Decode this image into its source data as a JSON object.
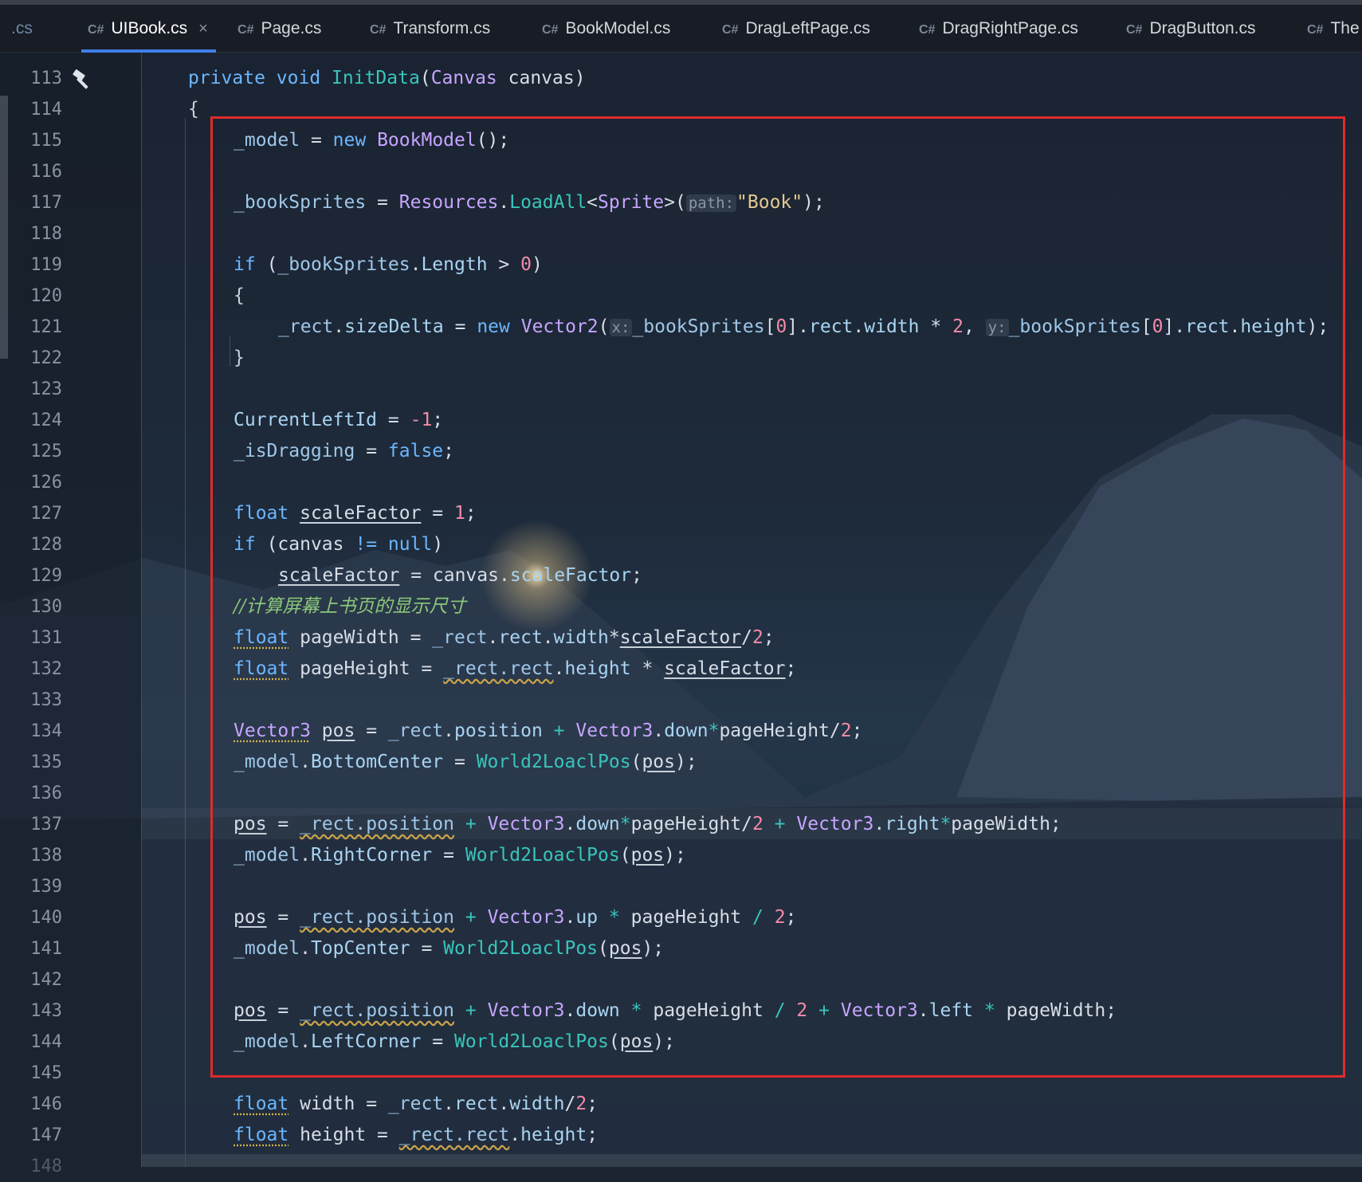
{
  "tabs": [
    {
      "lang": "",
      "name": ".cs",
      "active": false
    },
    {
      "lang": "C#",
      "name": "UIBook.cs",
      "active": true,
      "close": "×"
    },
    {
      "lang": "C#",
      "name": "Page.cs",
      "active": false
    },
    {
      "lang": "C#",
      "name": "Transform.cs",
      "active": false
    },
    {
      "lang": "C#",
      "name": "BookModel.cs",
      "active": false
    },
    {
      "lang": "C#",
      "name": "DragLeftPage.cs",
      "active": false
    },
    {
      "lang": "C#",
      "name": "DragRightPage.cs",
      "active": false
    },
    {
      "lang": "C#",
      "name": "DragButton.cs",
      "active": false
    },
    {
      "lang": "C#",
      "name": "The",
      "active": false
    }
  ],
  "line_numbers": [
    "113",
    "114",
    "115",
    "116",
    "117",
    "118",
    "119",
    "120",
    "121",
    "122",
    "123",
    "124",
    "125",
    "126",
    "127",
    "128",
    "129",
    "130",
    "131",
    "132",
    "133",
    "134",
    "135",
    "136",
    "137",
    "138",
    "139",
    "140",
    "141",
    "142",
    "143",
    "144",
    "145",
    "146",
    "147",
    "148"
  ],
  "hints": {
    "path": "path:",
    "x": "x:",
    "y": "y:"
  },
  "code_comment": "//计算屏幕上书页的显示尺寸",
  "code_lines": {
    "l113": "private void InitData(Canvas canvas)",
    "l114": "{",
    "l115": "_model = new BookModel();",
    "l117": "_bookSprites = Resources.LoadAll<Sprite>(\"Book\");",
    "l119": "if (_bookSprites.Length > 0)",
    "l120": "{",
    "l121": "_rect.sizeDelta = new Vector2(_bookSprites[0].rect.width * 2, _bookSprites[0].rect.height);",
    "l122": "}",
    "l124": "CurrentLeftId = -1;",
    "l125": "_isDragging = false;",
    "l127": "float scaleFactor = 1;",
    "l128": "if (canvas != null)",
    "l129": "scaleFactor = canvas.scaleFactor;",
    "l131": "float pageWidth = _rect.rect.width*scaleFactor/2;",
    "l132": "float pageHeight = _rect.rect.height * scaleFactor;",
    "l134": "Vector3 pos = _rect.position + Vector3.down*pageHeight/2;",
    "l135": "_model.BottomCenter = World2LoaclPos(pos);",
    "l137": "pos = _rect.position + Vector3.down*pageHeight/2 + Vector3.right*pageWidth;",
    "l138": "_model.RightCorner = World2LoaclPos(pos);",
    "l140": "pos = _rect.position + Vector3.up * pageHeight / 2;",
    "l141": "_model.TopCenter = World2LoaclPos(pos);",
    "l143": "pos = _rect.position + Vector3.down * pageHeight / 2 + Vector3.left * pageWidth;",
    "l144": "_model.LeftCorner = World2LoaclPos(pos);",
    "l146": "float width = _rect.rect.width/2;",
    "l147": "float height = _rect.rect.height;"
  },
  "theme": {
    "accent": "#3f7ee8",
    "highlight_box": "#e02a2a"
  },
  "icons": {
    "gutter": "hammer-icon",
    "tab_close": "close-icon"
  }
}
